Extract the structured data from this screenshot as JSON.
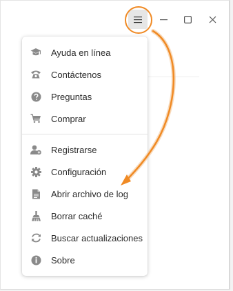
{
  "titlebar": {
    "menu_icon": "hamburger-icon",
    "minimize_icon": "minimize-icon",
    "maximize_icon": "maximize-icon",
    "close_icon": "close-icon"
  },
  "menu": {
    "items": [
      {
        "label": "Ayuda en línea",
        "icon": "graduation-cap-icon"
      },
      {
        "label": "Contáctenos",
        "icon": "phone-icon"
      },
      {
        "label": "Preguntas",
        "icon": "question-icon"
      },
      {
        "label": "Comprar",
        "icon": "cart-icon"
      },
      {
        "label": "Registrarse",
        "icon": "user-register-icon"
      },
      {
        "label": "Configuración",
        "icon": "gear-icon"
      },
      {
        "label": "Abrir archivo de log",
        "icon": "document-icon"
      },
      {
        "label": "Borrar caché",
        "icon": "broom-icon"
      },
      {
        "label": "Buscar actualizaciones",
        "icon": "refresh-icon"
      },
      {
        "label": "Sobre",
        "icon": "info-icon"
      }
    ]
  },
  "colors": {
    "highlight": "#f08a24",
    "icon_gray": "#8a8a8a"
  }
}
